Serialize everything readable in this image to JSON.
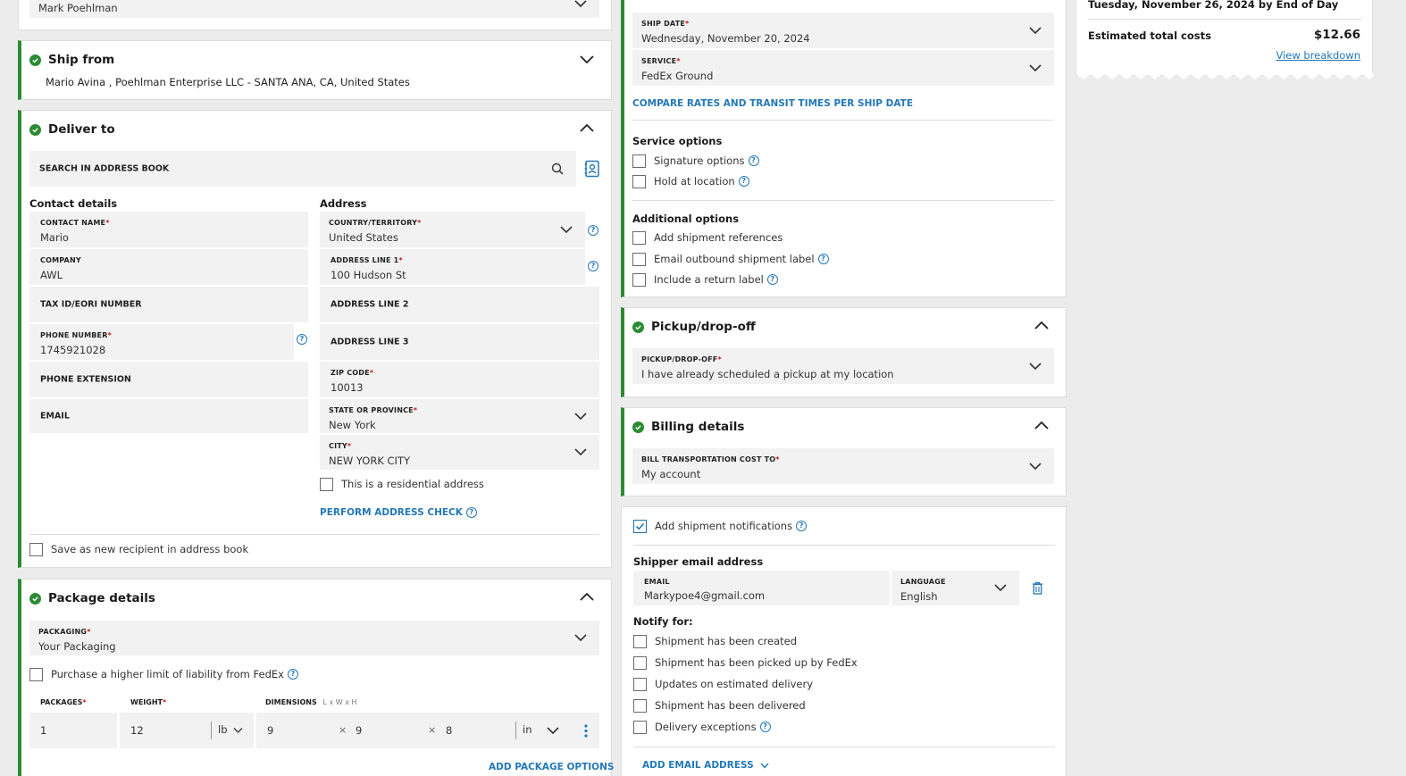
{
  "top_field": {
    "value": "Mark Poehlman"
  },
  "ship_from": {
    "title": "Ship from",
    "summary": "Mario Avina , Poehlman Enterprise LLC - SANTA ANA, CA, United States"
  },
  "deliver_to": {
    "title": "Deliver to",
    "search_placeholder": "SEARCH IN ADDRESS BOOK",
    "contact_heading": "Contact details",
    "address_heading": "Address",
    "contact_name": {
      "label": "CONTACT NAME",
      "value": "Mario"
    },
    "company": {
      "label": "COMPANY",
      "value": "AWL"
    },
    "tax_id": {
      "placeholder": "TAX ID/EORI NUMBER"
    },
    "phone": {
      "label": "PHONE NUMBER",
      "value": "1745921028"
    },
    "phone_ext": {
      "placeholder": "PHONE EXTENSION"
    },
    "email": {
      "placeholder": "EMAIL"
    },
    "country": {
      "label": "COUNTRY/TERRITORY",
      "value": "United States"
    },
    "address1": {
      "label": "ADDRESS LINE 1",
      "value": "100 Hudson St"
    },
    "address2": {
      "placeholder": "ADDRESS LINE 2"
    },
    "address3": {
      "placeholder": "ADDRESS LINE 3"
    },
    "zip": {
      "label": "ZIP CODE",
      "value": "10013"
    },
    "state": {
      "label": "STATE OR PROVINCE",
      "value": "New York"
    },
    "city": {
      "label": "CITY",
      "value": "NEW YORK CITY"
    },
    "residential_label": "This is a residential address",
    "address_check_label": "PERFORM ADDRESS CHECK",
    "save_recipient_label": "Save as new recipient in address book"
  },
  "package": {
    "title": "Package details",
    "packaging": {
      "label": "PACKAGING",
      "value": "Your Packaging"
    },
    "liability_label": "Purchase a higher limit of liability from FedEx",
    "packages_label": "PACKAGES",
    "weight_label": "WEIGHT",
    "dimensions_label": "DIMENSIONS",
    "dimensions_hint": "L x W x H",
    "packages_value": "1",
    "weight_value": "12",
    "weight_unit": "lb",
    "dim_l": "9",
    "dim_w": "9",
    "dim_h": "8",
    "dim_unit": "in",
    "times": "×",
    "add_options_label": "ADD PACKAGE OPTIONS"
  },
  "service": {
    "ship_date": {
      "label": "SHIP DATE",
      "value": "Wednesday, November 20, 2024"
    },
    "service": {
      "label": "SERVICE",
      "value": "FedEx Ground"
    },
    "compare_label": "COMPARE RATES AND TRANSIT TIMES PER SHIP DATE",
    "service_options_heading": "Service options",
    "signature_label": "Signature options",
    "hold_label": "Hold at location",
    "additional_heading": "Additional options",
    "references_label": "Add shipment references",
    "email_label_label": "Email outbound shipment label",
    "return_label": "Include a return label"
  },
  "pickup": {
    "title": "Pickup/drop-off",
    "field": {
      "label": "PICKUP/DROP-OFF",
      "value": "I have already scheduled a pickup at my location"
    }
  },
  "billing": {
    "title": "Billing details",
    "field": {
      "label": "BILL TRANSPORTATION COST TO",
      "value": "My account"
    }
  },
  "notifications": {
    "add_label": "Add shipment notifications",
    "shipper_heading": "Shipper email address",
    "email": {
      "label": "EMAIL",
      "value": "Markypoe4@gmail.com"
    },
    "language": {
      "label": "LANGUAGE",
      "value": "English"
    },
    "notify_heading": "Notify for:",
    "created": "Shipment has been created",
    "picked_up": "Shipment has been picked up by FedEx",
    "estimated": "Updates on estimated delivery",
    "delivered": "Shipment has been delivered",
    "exceptions": "Delivery exceptions",
    "add_email_label": "ADD EMAIL ADDRESS"
  },
  "summary": {
    "delivery_date": "Tuesday, November 26, 2024 by End of Day",
    "total_label": "Estimated total costs",
    "total_value": "$12.66",
    "breakdown_label": "View breakdown"
  },
  "help_glyph": "?",
  "colors": {
    "accent": "#2478b7",
    "success": "#2d8a34",
    "required": "#c4161c"
  }
}
